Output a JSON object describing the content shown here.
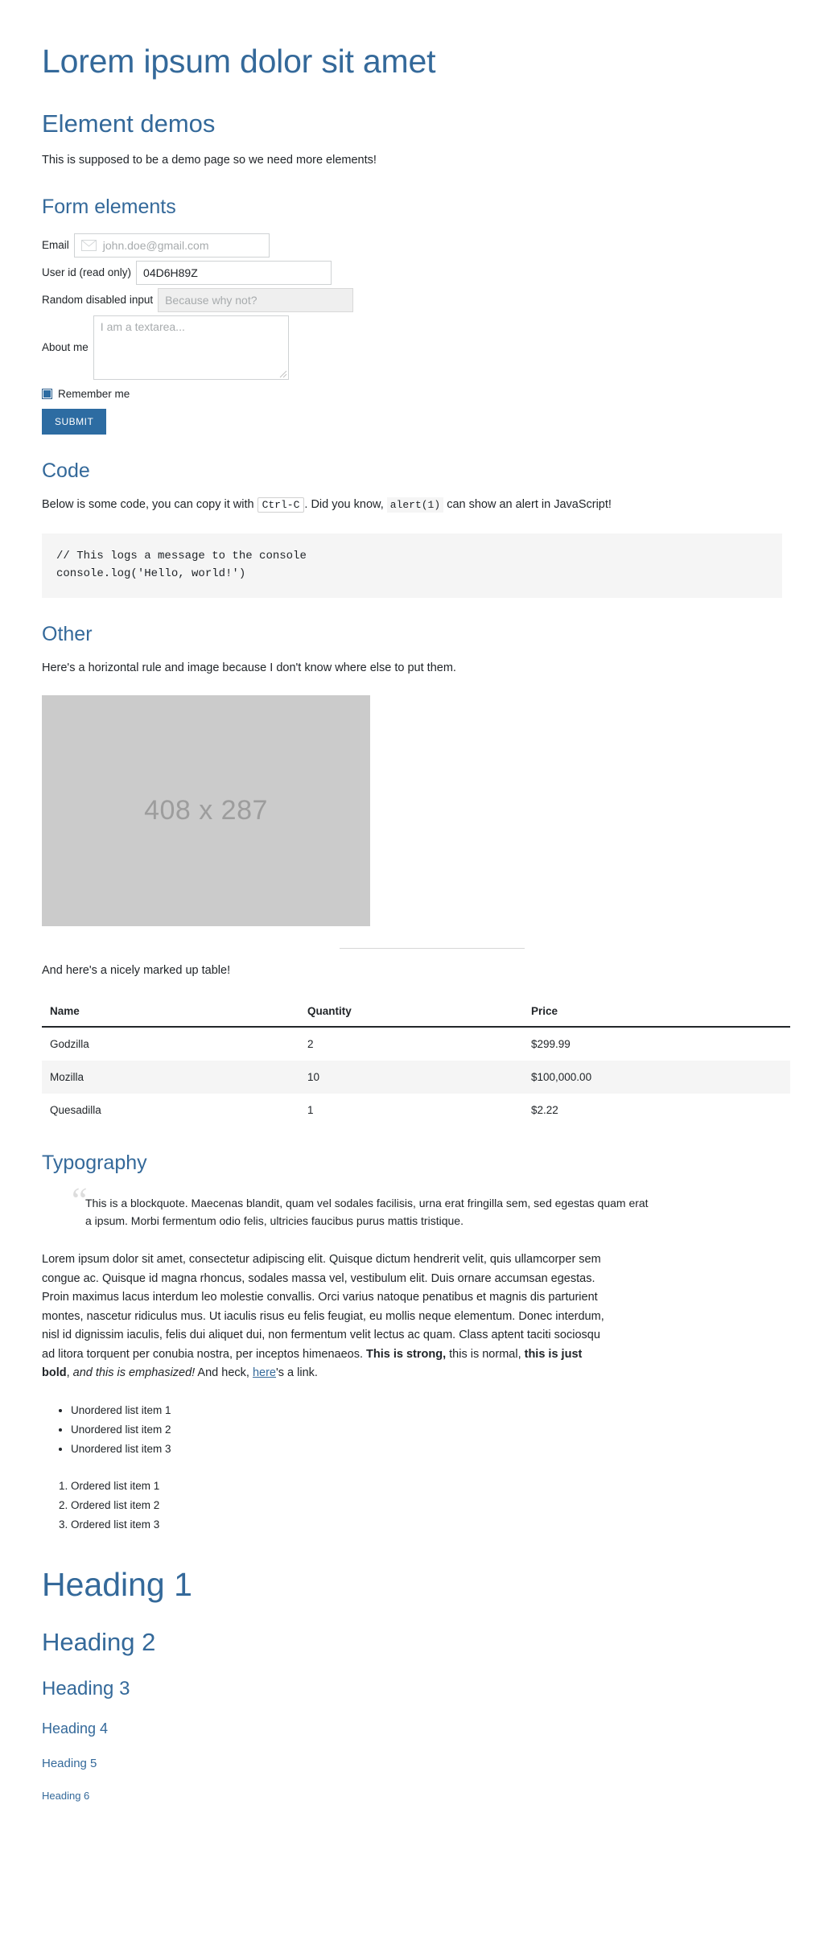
{
  "page": {
    "title": "Lorem ipsum dolor sit amet"
  },
  "element_demos": {
    "heading": "Element demos",
    "intro": "This is supposed to be a demo page so we need more elements!"
  },
  "form": {
    "heading": "Form elements",
    "email": {
      "label": "Email",
      "placeholder": "john.doe@gmail.com",
      "value": "",
      "icon": "mail-icon"
    },
    "user_id": {
      "label": "User id (read only)",
      "value": "04D6H89Z",
      "placeholder": ""
    },
    "disabled_input": {
      "label": "Random disabled input",
      "placeholder": "Because why not?",
      "value": ""
    },
    "about_me": {
      "label": "About me",
      "placeholder": "I am a textarea...",
      "value": ""
    },
    "remember_me": {
      "label": "Remember me",
      "checked": true
    },
    "submit_label": "SUBMIT"
  },
  "code": {
    "heading": "Code",
    "intro_1": "Below is some code, you can copy it with ",
    "kbd": "Ctrl-C",
    "intro_2": ". Did you know, ",
    "inline_code": "alert(1)",
    "intro_3": " can show an alert in JavaScript!",
    "block": "// This logs a message to the console\nconsole.log('Hello, world!')"
  },
  "other": {
    "heading": "Other",
    "intro": "Here's a horizontal rule and image because I don't know where else to put them.",
    "image_placeholder": "408 x 287",
    "table_intro": "And here's a nicely marked up table!"
  },
  "table": {
    "columns": [
      "Name",
      "Quantity",
      "Price"
    ],
    "rows": [
      {
        "name": "Godzilla",
        "quantity": "2",
        "price": "$299.99"
      },
      {
        "name": "Mozilla",
        "quantity": "10",
        "price": "$100,000.00"
      },
      {
        "name": "Quesadilla",
        "quantity": "1",
        "price": "$2.22"
      }
    ]
  },
  "typography": {
    "heading": "Typography",
    "blockquote": "This is a blockquote. Maecenas blandit, quam vel sodales facilisis, urna erat fringilla sem, sed egestas quam erat a ipsum. Morbi fermentum odio felis, ultricies faucibus purus mattis tristique.",
    "paragraph_1": "Lorem ipsum dolor sit amet, consectetur adipiscing elit. Quisque dictum hendrerit velit, quis ullamcorper sem congue ac. Quisque id magna rhoncus, sodales massa vel, vestibulum elit. Duis ornare accumsan egestas. Proin maximus lacus interdum leo molestie convallis. Orci varius natoque penatibus et magnis dis parturient montes, nascetur ridiculus mus. Ut iaculis risus eu felis feugiat, eu mollis neque elementum. Donec interdum, nisl id dignissim iaculis, felis dui aliquet dui, non fermentum velit lectus ac quam. Class aptent taciti sociosqu ad litora torquent per conubia nostra, per inceptos himenaeos. ",
    "strong": "This is strong,",
    "normal": " this is normal, ",
    "bold": "this is just bold",
    "comma": ", ",
    "emphasis": "and this is emphasized!",
    "link_prefix": " And heck, ",
    "link_text": "here",
    "link_suffix": "'s a link.",
    "unordered": [
      "Unordered list item 1",
      "Unordered list item 2",
      "Unordered list item 3"
    ],
    "ordered": [
      "Ordered list item 1",
      "Ordered list item 2",
      "Ordered list item 3"
    ]
  },
  "headings": {
    "h1": "Heading 1",
    "h2": "Heading 2",
    "h3": "Heading 3",
    "h4": "Heading 4",
    "h5": "Heading 5",
    "h6": "Heading 6"
  },
  "colors": {
    "heading_blue": "#34699a",
    "button_blue": "#2d6ca2",
    "code_bg": "#f5f5f5",
    "image_placeholder_bg": "#cbcbcb",
    "table_alt_row": "#f5f5f5",
    "text": "#212529"
  }
}
